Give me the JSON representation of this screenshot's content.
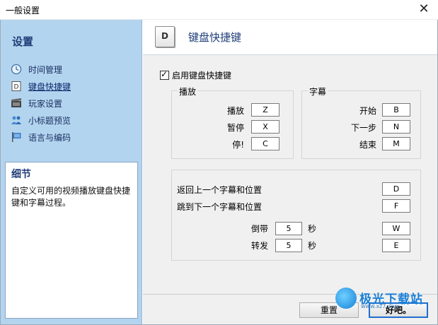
{
  "window": {
    "title": "一般设置"
  },
  "sidebar": {
    "heading": "设置",
    "items": [
      {
        "label": "时间管理",
        "icon": "clock-icon"
      },
      {
        "label": "键盘快捷键",
        "icon": "keyboard-key-icon",
        "active": true
      },
      {
        "label": "玩家设置",
        "icon": "film-icon"
      },
      {
        "label": "小标题预览",
        "icon": "people-icon"
      },
      {
        "label": "语言与编码",
        "icon": "flag-icon"
      }
    ],
    "detail": {
      "title": "细节",
      "text": "自定义可用的视频播放键盘快捷键和字幕过程。"
    }
  },
  "main": {
    "header_key": "D",
    "title": "键盘快捷键",
    "enable_label": "启用键盘快捷键",
    "enable_checked": true,
    "playback": {
      "title": "播放",
      "rows": [
        {
          "label": "播放",
          "key": "Z"
        },
        {
          "label": "暂停",
          "key": "X"
        },
        {
          "label": "停!",
          "key": "C"
        }
      ]
    },
    "subtitle": {
      "title": "字幕",
      "rows": [
        {
          "label": "开始",
          "key": "B"
        },
        {
          "label": "下一步",
          "key": "N"
        },
        {
          "label": "结束",
          "key": "M"
        }
      ]
    },
    "navigation": {
      "back_label": "返回上一个字幕和位置",
      "back_key": "D",
      "next_label": "跳到下一个字幕和位置",
      "next_key": "F",
      "rewind_label": "倒带",
      "rewind_value": "5",
      "rewind_unit": "秒",
      "rewind_key": "W",
      "forward_label": "转发",
      "forward_value": "5",
      "forward_unit": "秒",
      "forward_key": "E"
    },
    "reset_button": "重置",
    "ok_button": "好吧。"
  },
  "watermark": {
    "text": "极光下载站",
    "url": "www.xz7.com"
  }
}
